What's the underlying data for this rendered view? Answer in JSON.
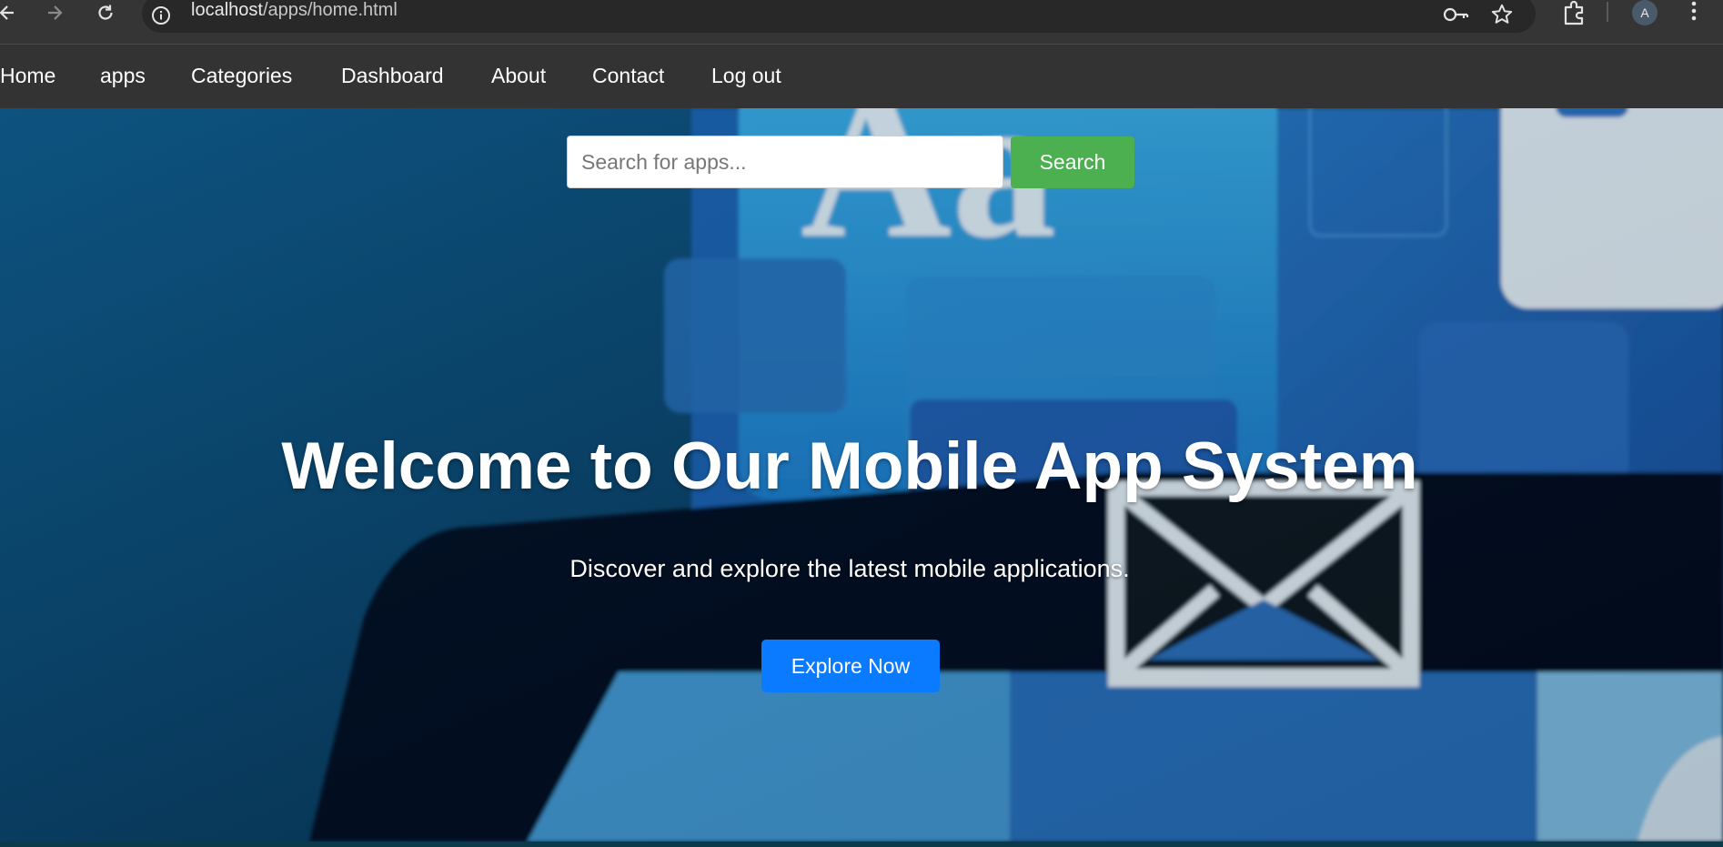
{
  "browser": {
    "url_host": "localhost",
    "url_path": "/apps/home.html",
    "profile_initial": "A",
    "icons": [
      "back-icon",
      "forward-icon",
      "reload-icon",
      "info-icon",
      "key-icon",
      "star-icon",
      "extensions-icon",
      "more-menu-icon"
    ]
  },
  "nav": {
    "items": [
      {
        "label": "Home"
      },
      {
        "label": "apps"
      },
      {
        "label": "Categories"
      },
      {
        "label": "Dashboard"
      },
      {
        "label": "About"
      },
      {
        "label": "Contact"
      },
      {
        "label": "Log out"
      }
    ]
  },
  "search": {
    "placeholder": "Search for apps...",
    "button_label": "Search",
    "button_color": "#4caf50"
  },
  "hero": {
    "title": "Welcome to Our Mobile App System",
    "subtitle": "Discover and explore the latest mobile applications.",
    "cta_label": "Explore Now",
    "cta_color": "#0a7bff"
  }
}
